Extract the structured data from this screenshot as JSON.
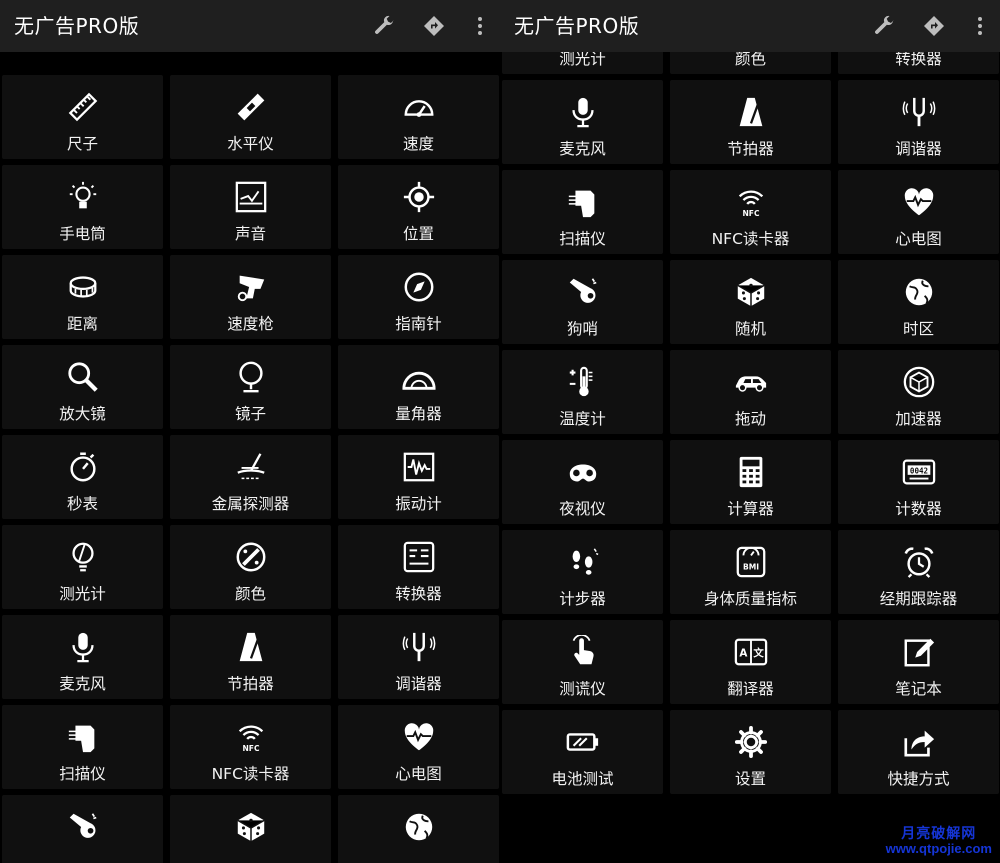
{
  "app": {
    "title": "无广告PRO版",
    "actions": [
      {
        "name": "wrench-icon"
      },
      {
        "name": "directions-icon"
      },
      {
        "name": "more-vert-icon"
      }
    ]
  },
  "left_panel": {
    "tiles": [
      {
        "label": "尺子",
        "icon": "ruler-icon"
      },
      {
        "label": "水平仪",
        "icon": "level-icon"
      },
      {
        "label": "速度",
        "icon": "speedometer-icon"
      },
      {
        "label": "手电筒",
        "icon": "bulb-icon"
      },
      {
        "label": "声音",
        "icon": "sound-meter-icon"
      },
      {
        "label": "位置",
        "icon": "gps-icon"
      },
      {
        "label": "距离",
        "icon": "tape-measure-icon"
      },
      {
        "label": "速度枪",
        "icon": "speed-gun-icon"
      },
      {
        "label": "指南针",
        "icon": "compass-icon"
      },
      {
        "label": "放大镜",
        "icon": "magnifier-icon"
      },
      {
        "label": "镜子",
        "icon": "mirror-icon"
      },
      {
        "label": "量角器",
        "icon": "protractor-icon"
      },
      {
        "label": "秒表",
        "icon": "stopwatch-icon"
      },
      {
        "label": "金属探测器",
        "icon": "metal-detector-icon"
      },
      {
        "label": "振动计",
        "icon": "vibration-icon"
      },
      {
        "label": "测光计",
        "icon": "light-meter-icon"
      },
      {
        "label": "颜色",
        "icon": "color-icon"
      },
      {
        "label": "转换器",
        "icon": "converter-icon"
      },
      {
        "label": "麦克风",
        "icon": "microphone-icon"
      },
      {
        "label": "节拍器",
        "icon": "metronome-icon"
      },
      {
        "label": "调谐器",
        "icon": "tuning-fork-icon"
      },
      {
        "label": "扫描仪",
        "icon": "scanner-icon"
      },
      {
        "label": "NFC读卡器",
        "icon": "nfc-icon"
      },
      {
        "label": "心电图",
        "icon": "heart-icon"
      },
      {
        "label": "",
        "icon": "whistle-icon"
      },
      {
        "label": "",
        "icon": "dice-icon"
      },
      {
        "label": "",
        "icon": "globe-icon"
      }
    ]
  },
  "right_panel": {
    "tiles": [
      {
        "label": "测光计",
        "icon": "light-meter-icon"
      },
      {
        "label": "颜色",
        "icon": "color-icon"
      },
      {
        "label": "转换器",
        "icon": "converter-icon"
      },
      {
        "label": "麦克风",
        "icon": "microphone-icon"
      },
      {
        "label": "节拍器",
        "icon": "metronome-icon"
      },
      {
        "label": "调谐器",
        "icon": "tuning-fork-icon"
      },
      {
        "label": "扫描仪",
        "icon": "scanner-icon"
      },
      {
        "label": "NFC读卡器",
        "icon": "nfc-icon"
      },
      {
        "label": "心电图",
        "icon": "heart-icon"
      },
      {
        "label": "狗哨",
        "icon": "whistle-icon"
      },
      {
        "label": "随机",
        "icon": "dice-icon"
      },
      {
        "label": "时区",
        "icon": "globe-icon"
      },
      {
        "label": "温度计",
        "icon": "thermometer-icon"
      },
      {
        "label": "拖动",
        "icon": "car-icon"
      },
      {
        "label": "加速器",
        "icon": "accelerometer-icon"
      },
      {
        "label": "夜视仪",
        "icon": "night-vision-icon"
      },
      {
        "label": "计算器",
        "icon": "calculator-icon"
      },
      {
        "label": "计数器",
        "icon": "counter-icon"
      },
      {
        "label": "计步器",
        "icon": "pedometer-icon"
      },
      {
        "label": "身体质量指标",
        "icon": "bmi-icon"
      },
      {
        "label": "经期跟踪器",
        "icon": "alarm-clock-icon"
      },
      {
        "label": "测谎仪",
        "icon": "finger-touch-icon"
      },
      {
        "label": "翻译器",
        "icon": "translator-icon"
      },
      {
        "label": "笔记本",
        "icon": "notebook-icon"
      },
      {
        "label": "电池测试",
        "icon": "battery-icon"
      },
      {
        "label": "设置",
        "icon": "settings-icon"
      },
      {
        "label": "快捷方式",
        "icon": "share-icon"
      }
    ]
  },
  "watermark": {
    "line1": "月亮破解网",
    "line2": "www.qtpojie.com"
  }
}
